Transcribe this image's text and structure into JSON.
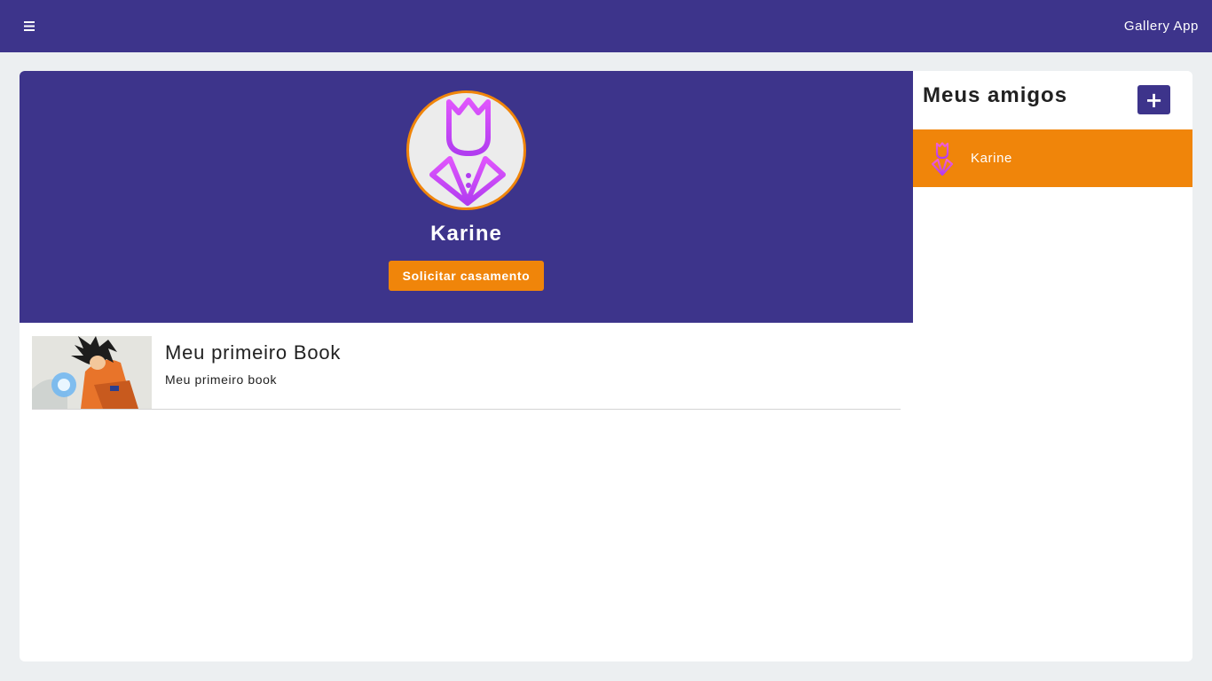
{
  "app": {
    "title": "Gallery App"
  },
  "colors": {
    "primary": "#3d348b",
    "accent": "#f0850a",
    "background": "#eceff1"
  },
  "icons": {
    "menu": "hamburger-menu-icon",
    "avatar": "crown-tuxedo-icon",
    "add": "plus-icon"
  },
  "profile": {
    "name": "Karine",
    "request_button": "Solicitar casamento"
  },
  "books": [
    {
      "title": "Meu primeiro Book",
      "description": "Meu primeiro book"
    }
  ],
  "friends": {
    "title": "Meus amigos",
    "add_label": "+",
    "items": [
      {
        "name": "Karine"
      }
    ]
  }
}
